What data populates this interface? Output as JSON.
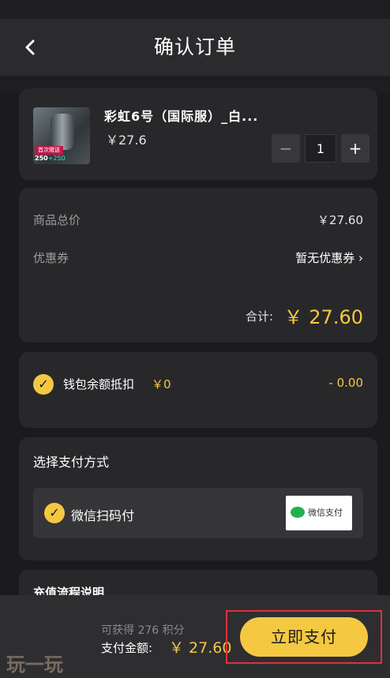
{
  "header": {
    "title": "确认订单",
    "back_icon": "chevron-left-icon"
  },
  "product": {
    "name": "彩虹6号（国际服）_白...",
    "price": "￥27.6",
    "thumb_tag": "首次赠送",
    "thumb_points_base": "250",
    "thumb_points_bonus": "+250",
    "quantity": "1",
    "minus_label": "−",
    "plus_label": "+"
  },
  "summary": {
    "subtotal_label": "商品总价",
    "subtotal_value": "￥27.60",
    "coupon_label": "优惠券",
    "coupon_value": "暂无优惠券",
    "total_label": "合计:",
    "total_value": "￥ 27.60"
  },
  "wallet": {
    "label": "钱包余额抵扣",
    "amount": "￥0",
    "deduct": "- 0.00"
  },
  "payment": {
    "title": "选择支付方式",
    "option_label": "微信扫码付",
    "logo_text": "微信支付"
  },
  "recharge": {
    "title": "充值流程说明"
  },
  "bottom_bar": {
    "points_text": "可获得 276 积分",
    "pay_label": "支付金额:",
    "pay_amount": "￥ 27.60",
    "pay_button": "立即支付"
  },
  "watermark": "玩一玩",
  "colors": {
    "accent": "#f5c842",
    "background": "#1b1b1d",
    "card": "#28282b",
    "highlight": "#e0303a"
  }
}
